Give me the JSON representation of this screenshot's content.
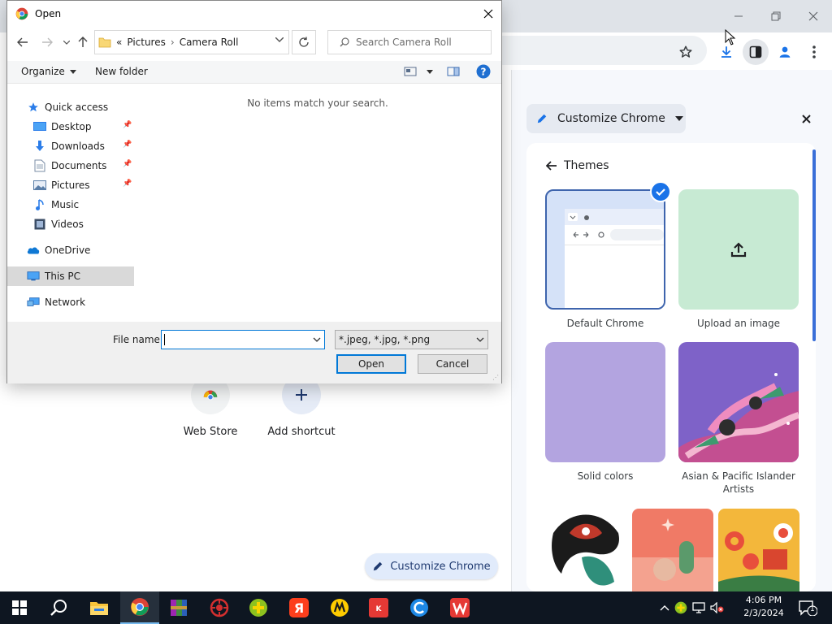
{
  "dialog": {
    "title": "Open",
    "breadcrumb": {
      "overflow": "«",
      "part1": "Pictures",
      "sep": "›",
      "part2": "Camera Roll"
    },
    "search_placeholder": "Search Camera Roll",
    "commands": {
      "organize": "Organize",
      "new_folder": "New folder"
    },
    "nav": {
      "quick_access": "Quick access",
      "desktop": "Desktop",
      "downloads": "Downloads",
      "documents": "Documents",
      "pictures": "Pictures",
      "music": "Music",
      "videos": "Videos",
      "onedrive": "OneDrive",
      "this_pc": "This PC",
      "network": "Network"
    },
    "empty_message": "No items match your search.",
    "file_name_label": "File name:",
    "file_name_value": "",
    "file_type": "*.jpeg, *.jpg, *.png",
    "open_button": "Open",
    "cancel_button": "Cancel"
  },
  "ntp": {
    "shortcuts": [
      {
        "label": "Web Store",
        "icon": "chrome-web-store-icon"
      },
      {
        "label": "Add shortcut",
        "icon": "plus-icon"
      }
    ],
    "customize_button": "Customize Chrome"
  },
  "side_panel": {
    "title": "Customize Chrome",
    "section": "Themes",
    "themes": [
      {
        "label": "Default Chrome",
        "selected": true
      },
      {
        "label": "Upload an image"
      },
      {
        "label": "Solid colors"
      },
      {
        "label": "Asian & Pacific Islander Artists"
      }
    ]
  },
  "taskbar": {
    "time": "4:06 PM",
    "date": "2/3/2024",
    "notification_count": "1",
    "apps": [
      "windows-start-icon",
      "search-icon",
      "file-explorer-icon",
      "chrome-icon",
      "winrar-icon",
      "antivirus-icon",
      "plus-app-icon",
      "yandex-icon",
      "yandex-market-icon",
      "kaspersky-icon",
      "ccleaner-icon",
      "wps-office-icon"
    ]
  },
  "colors": {
    "accent": "#1a73e8",
    "dialog_focus": "#0078d7",
    "taskbar": "#0e1621",
    "side_panel_bg": "#f6f8fc"
  }
}
